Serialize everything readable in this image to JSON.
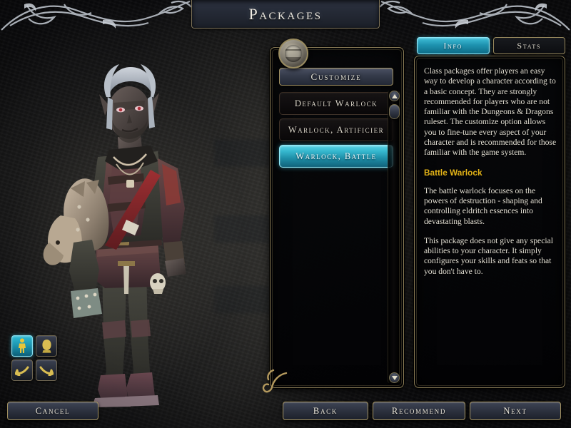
{
  "window": {
    "title": "Packages"
  },
  "character_panel": {
    "view_buttons": [
      {
        "name": "full-body-view",
        "icon": "body-icon",
        "active": true
      },
      {
        "name": "head-view",
        "icon": "head-icon",
        "active": false
      },
      {
        "name": "rotate-left",
        "icon": "rotate-left-icon",
        "active": false
      },
      {
        "name": "rotate-right",
        "icon": "rotate-right-icon",
        "active": false
      }
    ]
  },
  "list_panel": {
    "emblem_icon": "class-emblem-icon",
    "customize_label": "Customize",
    "items": [
      {
        "label": "Default Warlock",
        "selected": false
      },
      {
        "label": "Warlock, Artificier",
        "selected": false
      },
      {
        "label": "Warlock, Battle",
        "selected": true
      }
    ],
    "scrollbar": {
      "up_icon": "scroll-up-icon",
      "down_icon": "scroll-down-icon"
    }
  },
  "info_panel": {
    "tabs": [
      {
        "label": "Info",
        "active": true
      },
      {
        "label": "Stats",
        "active": false
      }
    ],
    "intro_text": "Class packages offer players an easy way to develop a character according to a basic concept. They are strongly recommended for players who are not familiar with the Dungeons & Dragons ruleset. The customize option allows you to fine-tune every aspect of your character and is recommended for those familiar with the game system.",
    "heading": "Battle Warlock",
    "paragraph_1": "The battle warlock focuses on the powers of destruction - shaping and controlling eldritch essences into devastating blasts.",
    "paragraph_2": "This package does not give any special abilities to your character. It simply configures your skills and feats so that you don't have to."
  },
  "footer": {
    "cancel_label": "Cancel",
    "back_label": "Back",
    "recommend_label": "Recommend",
    "next_label": "Next"
  },
  "colors": {
    "accent_cyan": "#35b6cd",
    "gold_border": "#9a8b5e",
    "heading_gold": "#e3b318",
    "text_light": "#e4e0d4"
  }
}
